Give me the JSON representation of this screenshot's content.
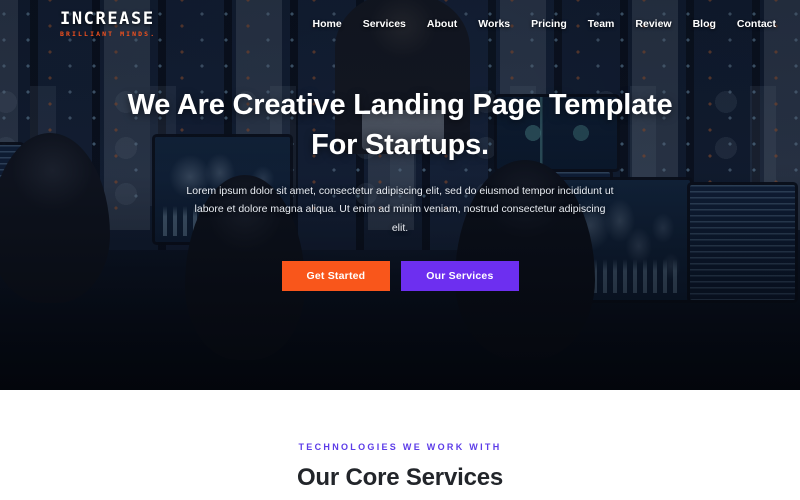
{
  "navbar": {
    "logo": {
      "main": "INCREASE",
      "sub": "BRILLIANT MINDS."
    },
    "links": [
      {
        "label": "Home"
      },
      {
        "label": "Services"
      },
      {
        "label": "About"
      },
      {
        "label": "Works"
      },
      {
        "label": "Pricing"
      },
      {
        "label": "Team"
      },
      {
        "label": "Review"
      },
      {
        "label": "Blog"
      },
      {
        "label": "Contact"
      }
    ]
  },
  "hero": {
    "title": "We Are Creative Landing Page Template For Startups.",
    "description": "Lorem ipsum dolor sit amet, consectetur adipiscing elit, sed do eiusmod tempor incididunt ut labore et dolore magna aliqua. Ut enim ad minim veniam, nostrud consectetur adipiscing elit.",
    "primary_button": "Get Started",
    "secondary_button": "Our Services"
  },
  "services": {
    "subtitle": "TECHNOLOGIES WE WORK WITH",
    "title": "Our Core Services"
  },
  "colors": {
    "accent_orange": "#f9561b",
    "accent_purple": "#6d2ff0",
    "subtitle_purple": "#5c3ce8",
    "logo_orange": "#f4511e",
    "heading_dark": "#22252a"
  }
}
